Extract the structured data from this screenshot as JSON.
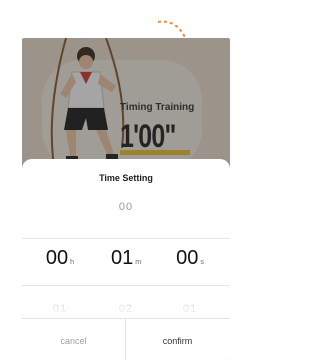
{
  "background_card": {
    "title": "Timing Training",
    "time": "1'00\""
  },
  "time_setting": {
    "title": "Time Setting",
    "columns": [
      {
        "above": "",
        "selected": "00",
        "unit": "h",
        "below": "01"
      },
      {
        "above": "00",
        "selected": "01",
        "unit": "m",
        "below": "02"
      },
      {
        "above": "",
        "selected": "00",
        "unit": "s",
        "below": "01"
      }
    ],
    "cancel_label": "cancel",
    "confirm_label": "confirm"
  },
  "colors": {
    "accent_arrow": "#f08a3c",
    "underline": "#f2c230"
  },
  "icons": [
    "curved-arrow-icon",
    "jump-rope-figure-illustration"
  ]
}
